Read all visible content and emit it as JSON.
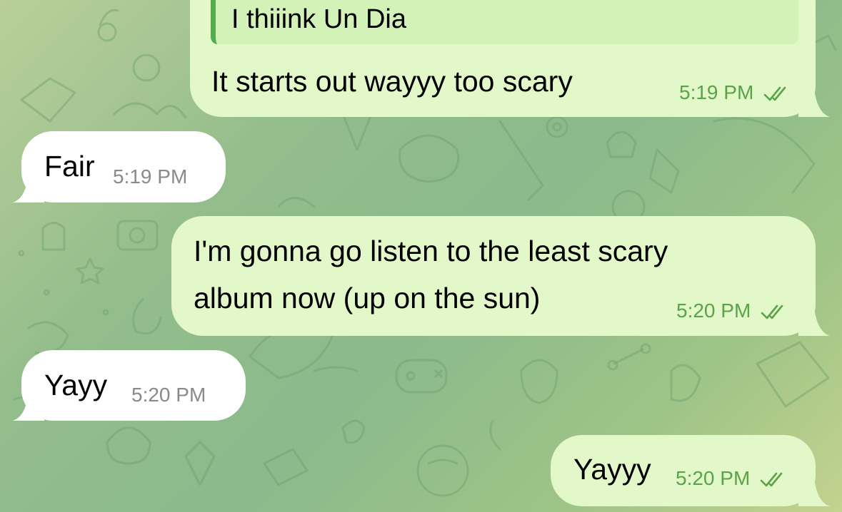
{
  "colors": {
    "outgoing_bubble": "#e2f8c8",
    "incoming_bubble": "#ffffff",
    "outgoing_time": "#5aa34a",
    "incoming_time": "#8a8a8e",
    "reply_bar": "#4fae4e"
  },
  "messages": [
    {
      "direction": "outgoing",
      "reply_quote": "I thiiink Un Dia",
      "text": "It starts out wayyy too scary",
      "time": "5:19 PM",
      "status_icon": "double-check-icon"
    },
    {
      "direction": "incoming",
      "text": "Fair",
      "time": "5:19 PM"
    },
    {
      "direction": "outgoing",
      "lines": [
        "I'm gonna go listen to the least scary",
        "album now (up on the sun)"
      ],
      "time": "5:20 PM",
      "status_icon": "double-check-icon"
    },
    {
      "direction": "incoming",
      "text": "Yayy",
      "time": "5:20 PM"
    },
    {
      "direction": "outgoing",
      "text": "Yayyy",
      "time": "5:20 PM",
      "status_icon": "double-check-icon"
    }
  ]
}
